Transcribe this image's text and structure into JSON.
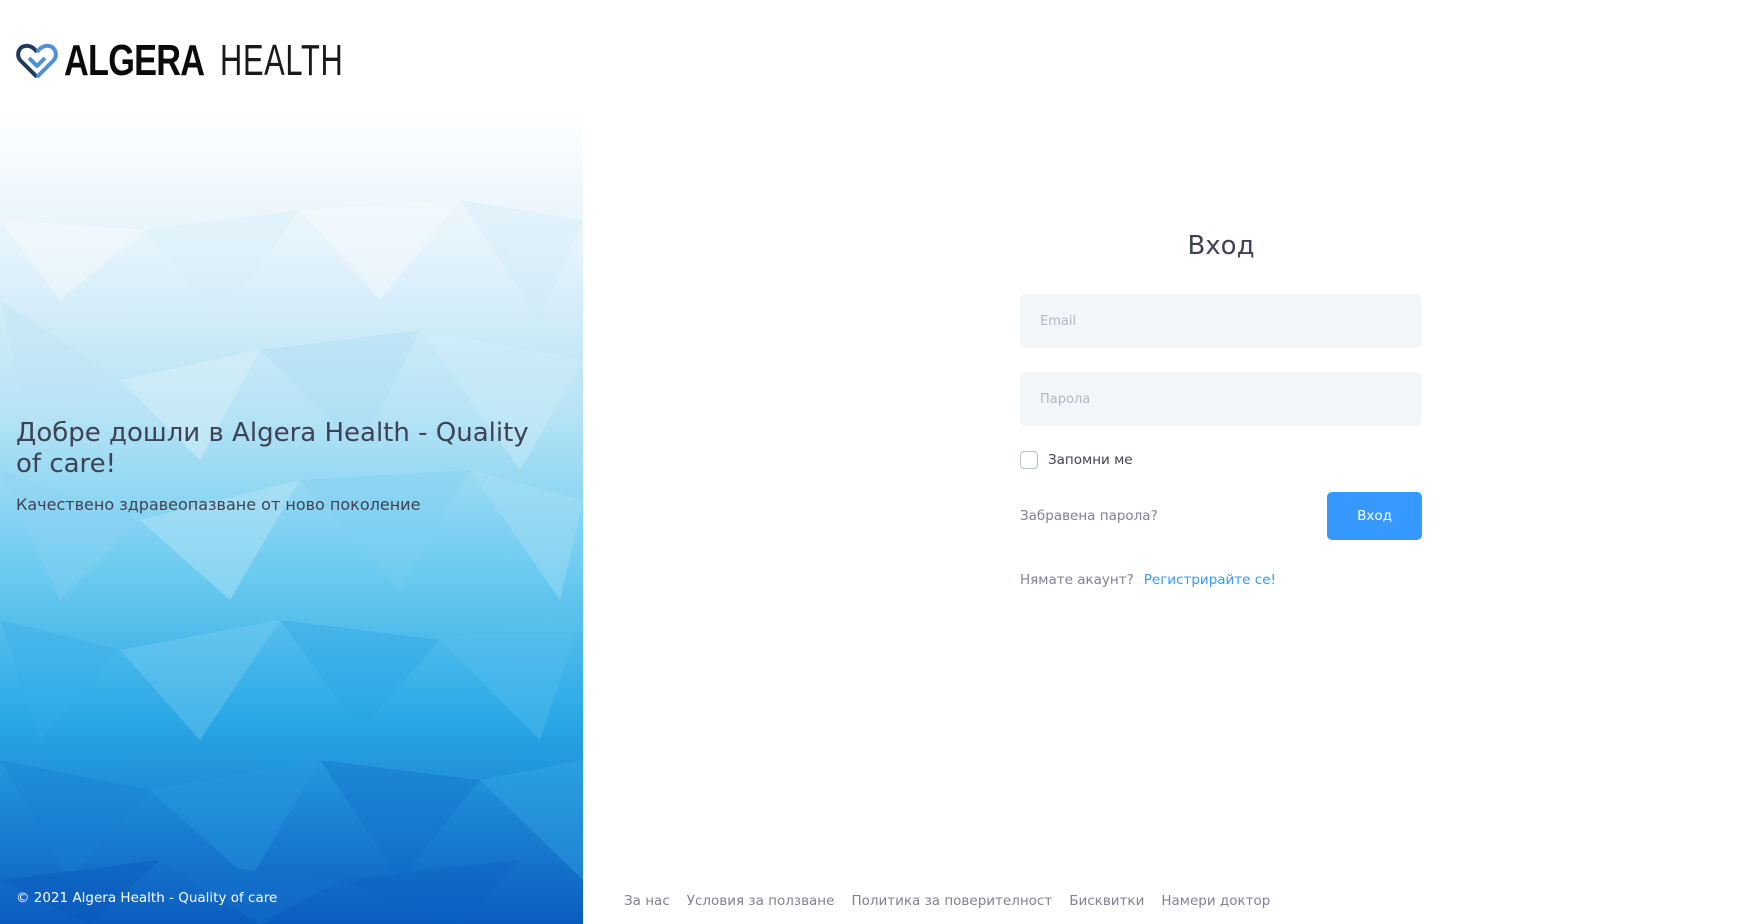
{
  "brand": {
    "logo_icon": "heart-logo-icon",
    "name_strong": "ALGERA",
    "name_light": "HEALTH",
    "colors": {
      "icon_dark": "#1e3a5f",
      "icon_light": "#4f8fd6"
    }
  },
  "aside": {
    "title": "Добре дошли в Algera Health - Quality of care!",
    "subtitle": "Качествено здравеопазване от ново поколение",
    "copyright": "© 2021 Algera Health - Quality of care",
    "background_colors": [
      "#ffffff",
      "#e6f3fb",
      "#a9dcf3",
      "#4cbdea",
      "#1a8fd8",
      "#0b5cbf"
    ]
  },
  "login": {
    "title": "Вход",
    "email_placeholder": "Email",
    "password_placeholder": "Парола",
    "remember_label": "Запомни ме",
    "remember_checked": false,
    "forgot_label": "Забравена парола?",
    "submit_label": "Вход",
    "no_account_text": "Нямате акаунт?",
    "register_label": "Регистрирайте се!"
  },
  "footer": {
    "links": [
      "За нас",
      "Условия за ползване",
      "Политика за поверителност",
      "Бисквитки",
      "Намери доктор"
    ]
  },
  "colors": {
    "primary": "#3699ff",
    "text": "#3f4254",
    "muted": "#7e8299",
    "input_bg": "#f3f6f9"
  }
}
